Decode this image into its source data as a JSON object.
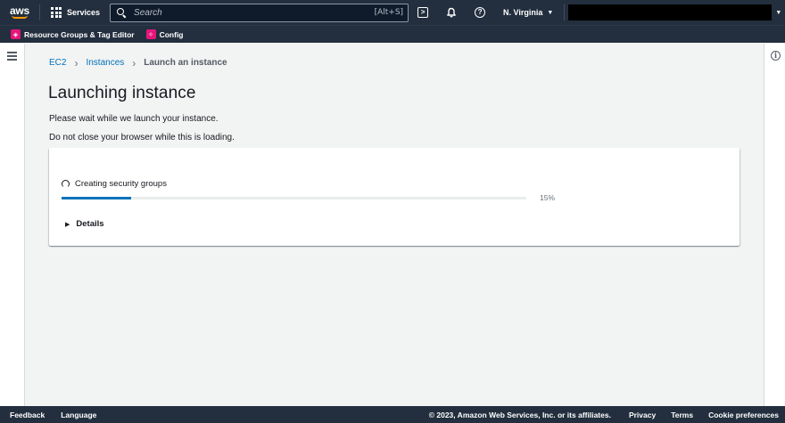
{
  "topnav": {
    "logo_text": "aws",
    "services_label": "Services",
    "search_placeholder": "Search",
    "search_shortcut": "[Alt+S]",
    "region_label": "N. Virginia"
  },
  "favorites": {
    "items": [
      {
        "label": "Resource Groups & Tag Editor",
        "icon": "resource-groups-icon"
      },
      {
        "label": "Config",
        "icon": "config-icon"
      }
    ]
  },
  "breadcrumb": {
    "items": [
      "EC2",
      "Instances"
    ],
    "current": "Launch an instance"
  },
  "page": {
    "title": "Launching instance",
    "message_1": "Please wait while we launch your instance.",
    "message_2": "Do not close your browser while this is loading."
  },
  "progress": {
    "status_text": "Creating security groups",
    "percent": 15,
    "percent_label": "15%",
    "details_label": "Details"
  },
  "footer": {
    "feedback": "Feedback",
    "language": "Language",
    "copyright": "© 2023, Amazon Web Services, Inc. or its affiliates.",
    "privacy": "Privacy",
    "terms": "Terms",
    "cookies": "Cookie preferences"
  },
  "colors": {
    "nav_bg": "#232f3e",
    "accent_orange": "#ff9900",
    "link_blue": "#0073bb",
    "progress_fill": "#0073bb",
    "page_bg": "#f2f3f3"
  }
}
